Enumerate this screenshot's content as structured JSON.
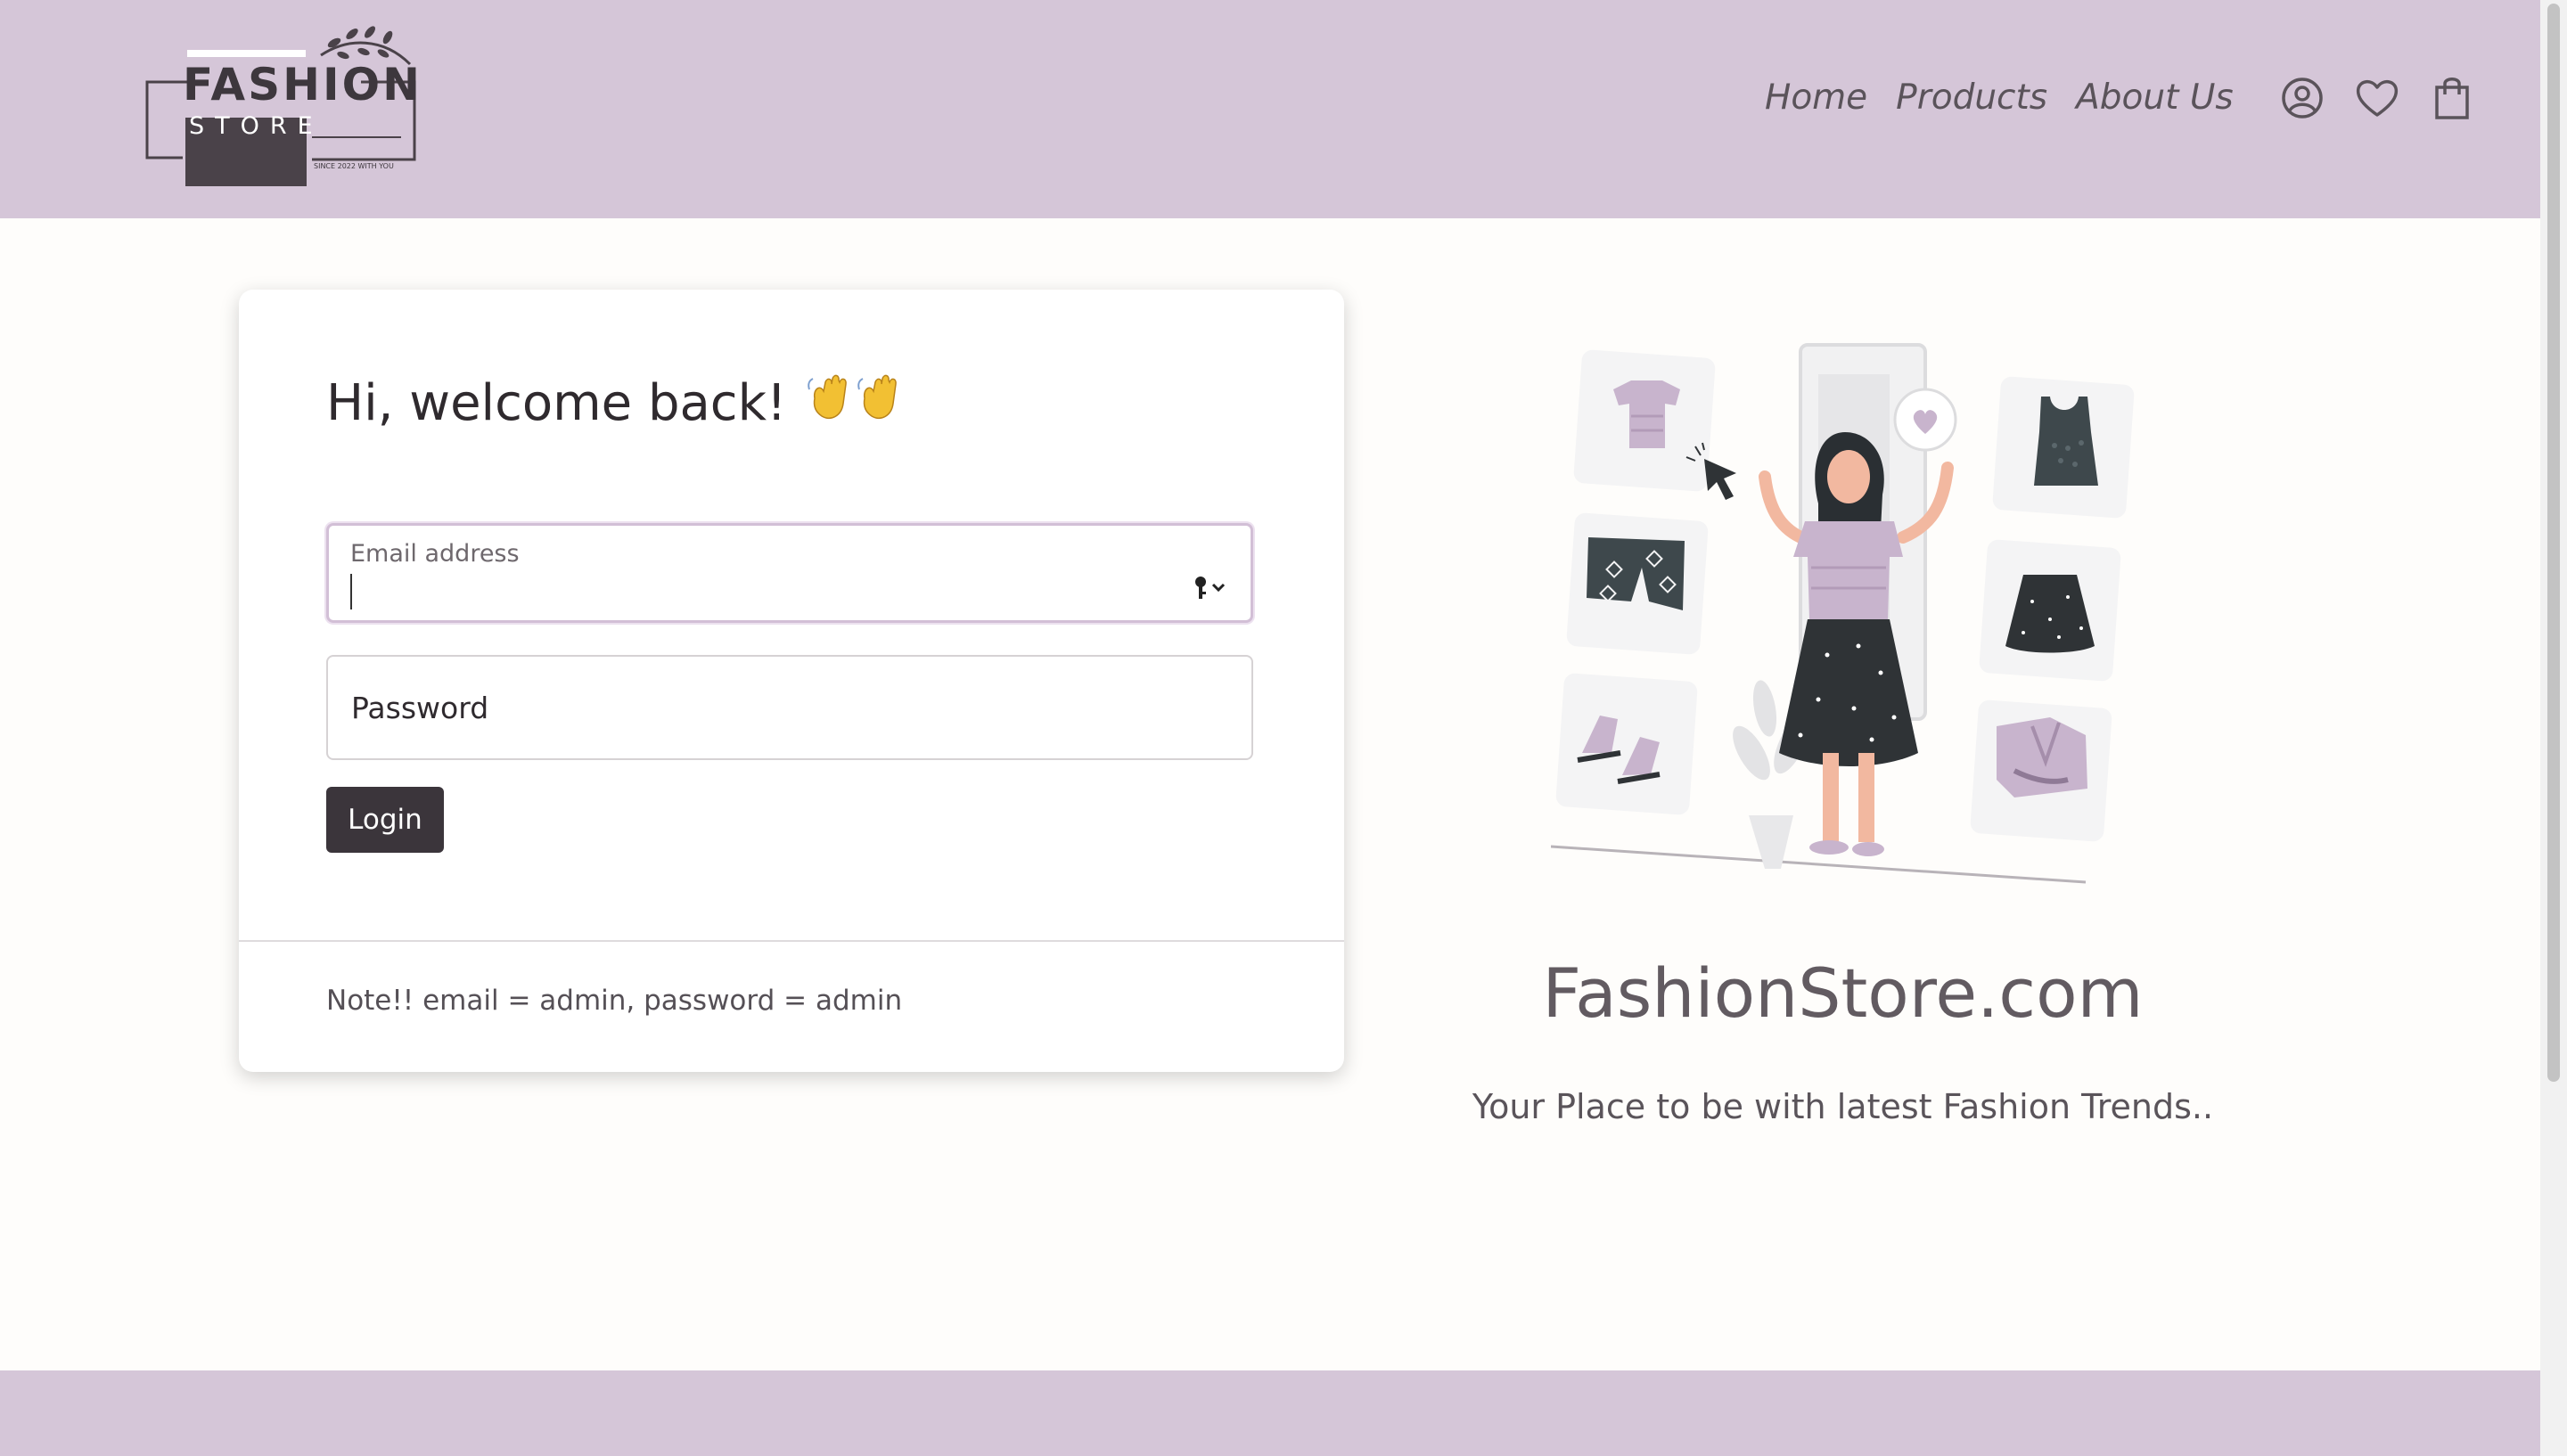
{
  "brand": {
    "logo_line1": "FASHION",
    "logo_line2": "STORE",
    "logo_tagline": "SINCE 2022 WITH YOU"
  },
  "nav": {
    "items": [
      {
        "label": "Home"
      },
      {
        "label": "Products"
      },
      {
        "label": "About Us"
      }
    ],
    "icons": [
      "user-icon",
      "heart-icon",
      "shopping-bag-icon"
    ]
  },
  "login": {
    "heading": "Hi, welcome back!",
    "heading_emoji": "waving-hands",
    "email": {
      "label": "Email address",
      "value": ""
    },
    "password": {
      "placeholder": "Password",
      "value": ""
    },
    "submit_label": "Login",
    "note": "Note!! email = admin, password = admin"
  },
  "promo": {
    "title": "FashionStore.com",
    "subtitle": "Your Place to be with latest Fashion Trends.."
  },
  "colors": {
    "header_bg": "#d5c6d8",
    "accent_dark": "#3b353b",
    "page_bg": "#fefdfb"
  }
}
